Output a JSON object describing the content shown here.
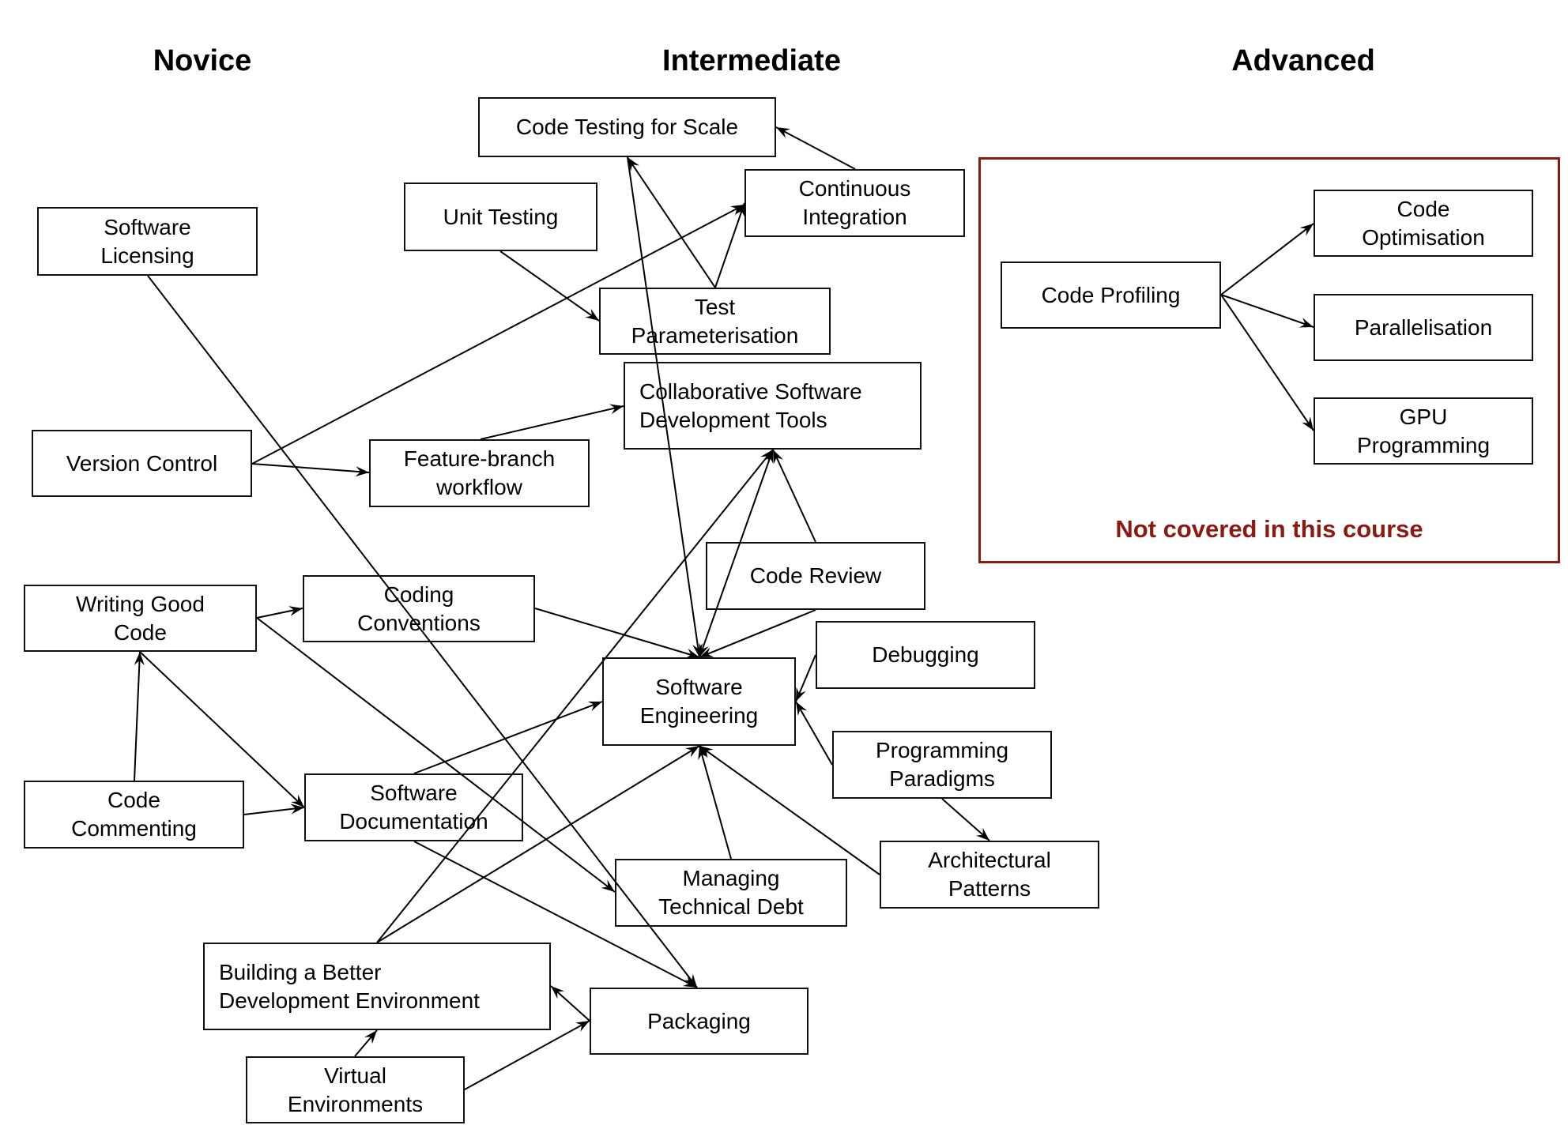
{
  "columns": {
    "novice": "Novice",
    "intermediate": "Intermediate",
    "advanced": "Advanced"
  },
  "scope_note": {
    "label": "Not covered in this course",
    "color": "#8b1a12"
  },
  "nodes": {
    "software_licensing": "Software\nLicensing",
    "version_control": "Version Control",
    "writing_good_code": "Writing Good\nCode",
    "code_commenting": "Code\nCommenting",
    "coding_conventions": "Coding\nConventions",
    "software_documentation": "Software\nDocumentation",
    "feature_branch": "Feature-branch\nworkflow",
    "unit_testing": "Unit Testing",
    "code_testing_scale": "Code Testing for Scale",
    "continuous_integration": "Continuous\nIntegration",
    "test_parameterisation": "Test\nParameterisation",
    "collab_tools": "Collaborative Software\nDevelopment Tools",
    "code_review": "Code Review",
    "debugging": "Debugging",
    "software_engineering": "Software\nEngineering",
    "programming_paradigms": "Programming\nParadigms",
    "architectural_patterns": "Architectural\nPatterns",
    "managing_tech_debt": "Managing\nTechnical Debt",
    "better_dev_env": "Building a Better\nDevelopment Environment",
    "packaging": "Packaging",
    "virtual_envs": "Virtual\nEnvironments",
    "code_profiling": "Code Profiling",
    "code_optimisation": "Code\nOptimisation",
    "parallelisation": "Parallelisation",
    "gpu_programming": "GPU\nProgramming"
  },
  "edges": [
    {
      "from": "software_licensing",
      "to": "packaging"
    },
    {
      "from": "version_control",
      "to": "continuous_integration"
    },
    {
      "from": "version_control",
      "to": "feature_branch"
    },
    {
      "from": "feature_branch",
      "to": "collab_tools"
    },
    {
      "from": "unit_testing",
      "to": "test_parameterisation"
    },
    {
      "from": "test_parameterisation",
      "to": "code_testing_scale"
    },
    {
      "from": "test_parameterisation",
      "to": "continuous_integration"
    },
    {
      "from": "continuous_integration",
      "to": "code_testing_scale"
    },
    {
      "from": "code_testing_scale",
      "to": "software_engineering"
    },
    {
      "from": "code_review",
      "to": "collab_tools"
    },
    {
      "from": "code_review",
      "to": "software_engineering"
    },
    {
      "from": "collab_tools",
      "to": "software_engineering",
      "bidirectional": true
    },
    {
      "from": "better_dev_env",
      "to": "collab_tools"
    },
    {
      "from": "coding_conventions",
      "to": "software_engineering"
    },
    {
      "from": "debugging",
      "to": "software_engineering"
    },
    {
      "from": "programming_paradigms",
      "to": "software_engineering"
    },
    {
      "from": "programming_paradigms",
      "to": "architectural_patterns"
    },
    {
      "from": "architectural_patterns",
      "to": "software_engineering"
    },
    {
      "from": "managing_tech_debt",
      "to": "software_engineering"
    },
    {
      "from": "software_documentation",
      "to": "software_engineering"
    },
    {
      "from": "better_dev_env",
      "to": "software_engineering"
    },
    {
      "from": "writing_good_code",
      "to": "coding_conventions"
    },
    {
      "from": "writing_good_code",
      "to": "managing_tech_debt"
    },
    {
      "from": "writing_good_code",
      "to": "software_documentation"
    },
    {
      "from": "code_commenting",
      "to": "writing_good_code"
    },
    {
      "from": "code_commenting",
      "to": "software_documentation"
    },
    {
      "from": "software_documentation",
      "to": "packaging"
    },
    {
      "from": "packaging",
      "to": "better_dev_env"
    },
    {
      "from": "virtual_envs",
      "to": "better_dev_env"
    },
    {
      "from": "virtual_envs",
      "to": "packaging"
    },
    {
      "from": "code_profiling",
      "to": "code_optimisation"
    },
    {
      "from": "code_profiling",
      "to": "parallelisation"
    },
    {
      "from": "code_profiling",
      "to": "gpu_programming"
    }
  ]
}
